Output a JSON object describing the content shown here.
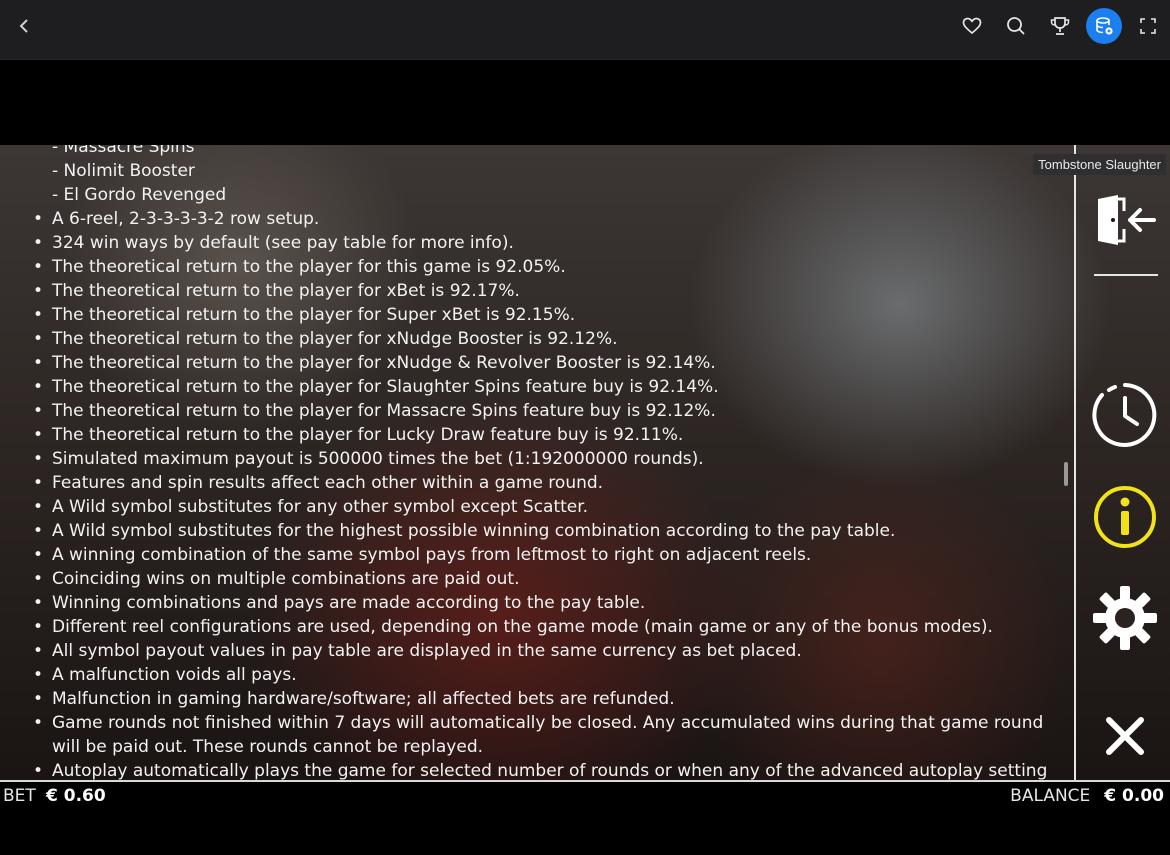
{
  "topbar": {
    "icons": [
      "back-icon",
      "heart-icon",
      "search-icon",
      "trophy-icon",
      "wallet-icon",
      "fullscreen-icon"
    ],
    "active_color": "#1c7ff0"
  },
  "game": {
    "title": "Tombstone Slaughter",
    "rules_partial_top": "- Massacre Spins",
    "rules_sub": [
      "- Nolimit Booster",
      "- El Gordo Revenged"
    ],
    "rules": [
      "A 6-reel, 2-3-3-3-3-2 row setup.",
      "324 win ways by default (see pay table for more info).",
      "The theoretical return to the player for this game is 92.05%.",
      "The theoretical return to the player for xBet is 92.17%.",
      "The theoretical return to the player for Super xBet is 92.15%.",
      "The theoretical return to the player for xNudge Booster is 92.12%.",
      "The theoretical return to the player for xNudge & Revolver Booster is 92.14%.",
      "The theoretical return to the player for Slaughter Spins feature buy is 92.14%.",
      "The theoretical return to the player for Massacre Spins feature buy is 92.12%.",
      "The theoretical return to the player for Lucky Draw feature buy is 92.11%.",
      "Simulated maximum payout is 500000 times the bet (1:192000000 rounds).",
      "Features and spin results affect each other within a game round.",
      "A Wild symbol substitutes for any other symbol except Scatter.",
      "A Wild symbol substitutes for the highest possible winning combination according to the pay table.",
      "A winning combination of the same symbol pays from leftmost to right on adjacent reels.",
      "Coinciding wins on multiple combinations are paid out.",
      "Winning combinations and pays are made according to the pay table.",
      "Different reel configurations are used, depending on the game mode (main game or any of the bonus modes).",
      "All symbol payout values in pay table are displayed in the same currency as bet placed.",
      "A malfunction voids all pays.",
      "Malfunction in gaming hardware/software; all affected bets are refunded.",
      "Game rounds not finished within 7 days will automatically be closed. Any accumulated wins during that game round will be paid out. These rounds cannot be replayed.",
      "Autoplay automatically plays the game for selected number of rounds or when any of the advanced autoplay setting"
    ]
  },
  "side": {
    "buttons": [
      "exit-icon",
      "history-icon",
      "info-icon",
      "settings-icon",
      "close-icon"
    ],
    "info_color": "#f2e318"
  },
  "bottom": {
    "bet_label": "BET",
    "bet_value": "€ 0.60",
    "balance_label": "BALANCE",
    "balance_value": "€ 0.00"
  }
}
